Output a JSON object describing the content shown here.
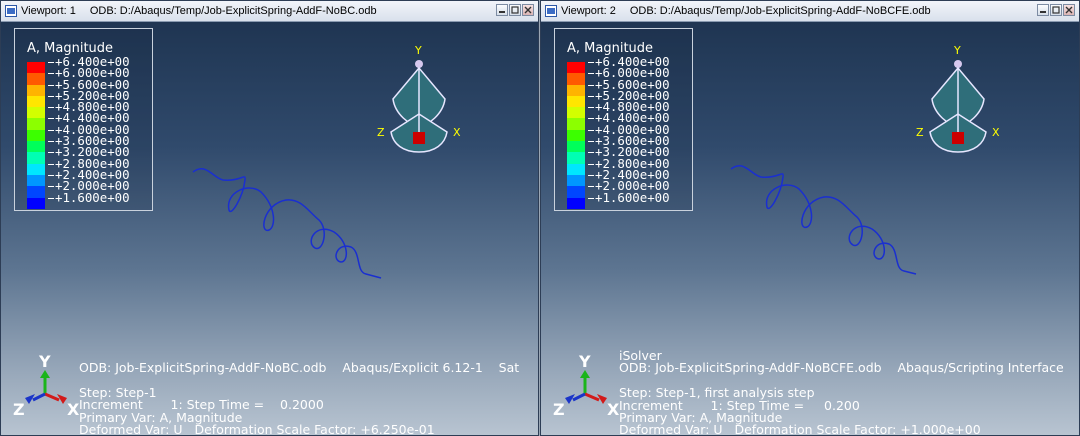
{
  "viewports": [
    {
      "title_label": "Viewport: 1",
      "odb_path": "ODB: D:/Abaqus/Temp/Job-ExplicitSpring-AddF-NoBC.odb",
      "legend": {
        "title": "A, Magnitude",
        "labels": [
          "+6.400e+00",
          "+6.000e+00",
          "+5.600e+00",
          "+5.200e+00",
          "+4.800e+00",
          "+4.400e+00",
          "+4.000e+00",
          "+3.600e+00",
          "+3.200e+00",
          "+2.800e+00",
          "+2.400e+00",
          "+2.000e+00",
          "+1.600e+00"
        ]
      },
      "info_lines": [
        "ODB: Job-ExplicitSpring-AddF-NoBC.odb    Abaqus/Explicit 6.12-1    Sat",
        "",
        "Step: Step-1",
        "Increment       1: Step Time =    0.2000",
        "Primary Var: A, Magnitude",
        "Deformed Var: U   Deformation Scale Factor: +6.250e-01"
      ]
    },
    {
      "title_label": "Viewport: 2",
      "odb_path": "ODB: D:/Abaqus/Temp/Job-ExplicitSpring-AddF-NoBCFE.odb",
      "legend": {
        "title": "A, Magnitude",
        "labels": [
          "+6.400e+00",
          "+6.000e+00",
          "+5.600e+00",
          "+5.200e+00",
          "+4.800e+00",
          "+4.400e+00",
          "+4.000e+00",
          "+3.600e+00",
          "+3.200e+00",
          "+2.800e+00",
          "+2.400e+00",
          "+2.000e+00",
          "+1.600e+00"
        ]
      },
      "info_lines": [
        "iSolver",
        "ODB: Job-ExplicitSpring-AddF-NoBCFE.odb    Abaqus/Scripting Interface",
        "",
        "Step: Step-1, first analysis step",
        "Increment       1: Step Time =     0.200",
        "Primary Var: A, Magnitude",
        "Deformed Var: U   Deformation Scale Factor: +1.000e+00"
      ]
    }
  ],
  "legend_colors": [
    "#ff0000",
    "#ff5a00",
    "#ffb400",
    "#ffe600",
    "#d2ff00",
    "#8cff00",
    "#3cff00",
    "#00ff5a",
    "#00ffb4",
    "#00e6ff",
    "#0096ff",
    "#0046ff",
    "#0000ff"
  ],
  "axis_labels": {
    "x": "X",
    "y": "Y",
    "z": "Z"
  },
  "spring_color": "#1a2fd0",
  "icons": {
    "viewport": "viewport-icon",
    "minimize": "minimize-icon",
    "maximize": "maximize-icon",
    "close": "close-icon"
  }
}
